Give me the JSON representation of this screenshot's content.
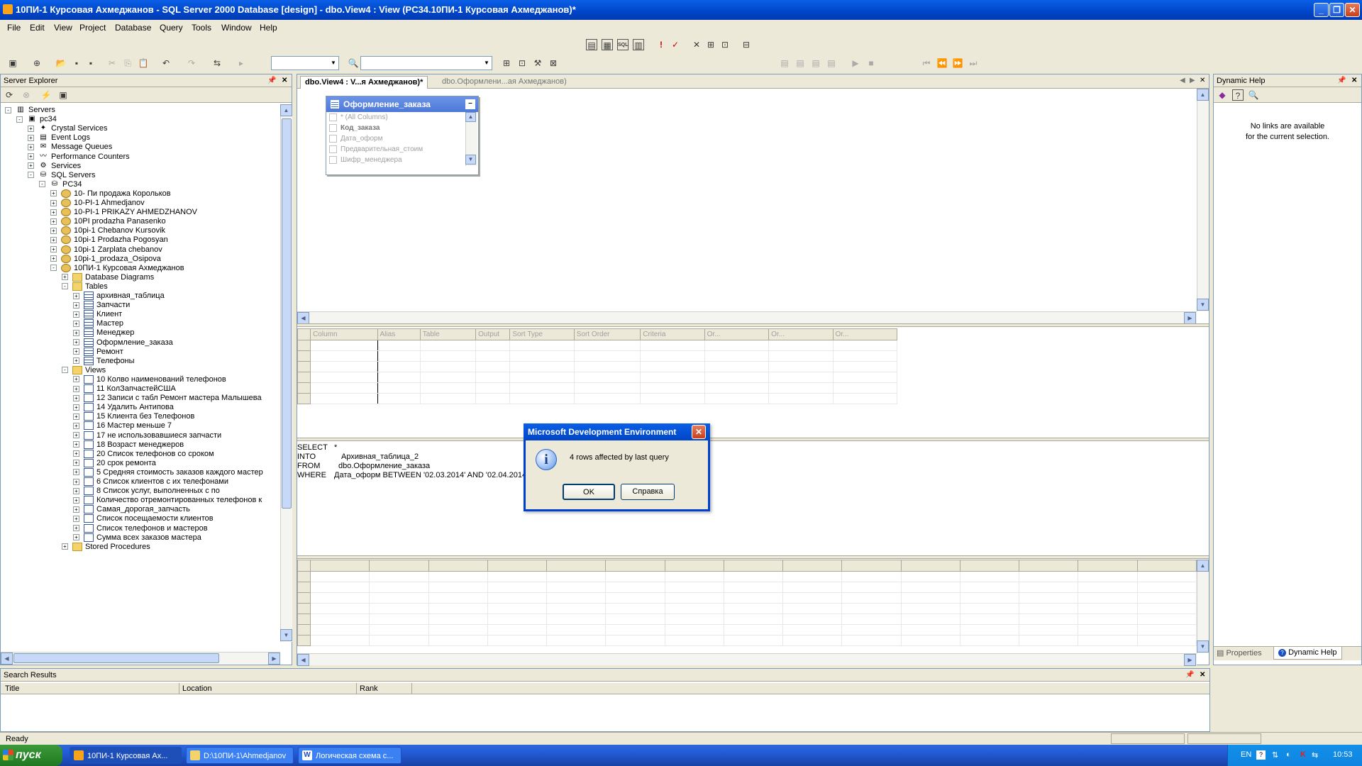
{
  "window": {
    "title": "10ПИ-1 Курсовая Ахмеджанов - SQL Server 2000 Database [design] - dbo.View4 : View (PC34.10ПИ-1 Курсовая Ахмеджанов)*"
  },
  "menu": [
    "File",
    "Edit",
    "View",
    "Project",
    "Database",
    "Query",
    "Tools",
    "Window",
    "Help"
  ],
  "server_explorer": {
    "title": "Server Explorer",
    "tree": [
      {
        "label": "Servers",
        "level": 0,
        "exp": "-",
        "icon": "servers-icon"
      },
      {
        "label": "pc34",
        "level": 1,
        "exp": "-",
        "icon": "computer-icon"
      },
      {
        "label": "Crystal Services",
        "level": 2,
        "exp": "+",
        "icon": "crystal-icon"
      },
      {
        "label": "Event Logs",
        "level": 2,
        "exp": "+",
        "icon": "event-log-icon"
      },
      {
        "label": "Message Queues",
        "level": 2,
        "exp": "+",
        "icon": "message-queue-icon"
      },
      {
        "label": "Performance Counters",
        "level": 2,
        "exp": "+",
        "icon": "perf-counter-icon"
      },
      {
        "label": "Services",
        "level": 2,
        "exp": "+",
        "icon": "services-icon"
      },
      {
        "label": "SQL Servers",
        "level": 2,
        "exp": "-",
        "icon": "sql-servers-icon"
      },
      {
        "label": "PC34",
        "level": 3,
        "exp": "-",
        "icon": "sql-server-icon"
      },
      {
        "label": "10- Пи продажа Корольков",
        "level": 4,
        "exp": "+",
        "icon": "database-icon"
      },
      {
        "label": "10-PI-1 Ahmedjanov",
        "level": 4,
        "exp": "+",
        "icon": "database-icon"
      },
      {
        "label": "10-PI-1 PRIKAZY AHMEDZHANOV",
        "level": 4,
        "exp": "+",
        "icon": "database-icon"
      },
      {
        "label": "10PI prodazha Panasenko",
        "level": 4,
        "exp": "+",
        "icon": "database-icon"
      },
      {
        "label": "10pi-1 Chebanov Kursovik",
        "level": 4,
        "exp": "+",
        "icon": "database-icon"
      },
      {
        "label": "10pi-1 Prodazha Pogosyan",
        "level": 4,
        "exp": "+",
        "icon": "database-icon"
      },
      {
        "label": "10pi-1 Zarplata chebanov",
        "level": 4,
        "exp": "+",
        "icon": "database-icon"
      },
      {
        "label": "10pi-1_prodaza_Osipova",
        "level": 4,
        "exp": "+",
        "icon": "database-icon"
      },
      {
        "label": "10ПИ-1 Курсовая Ахмеджанов",
        "level": 4,
        "exp": "-",
        "icon": "database-icon"
      },
      {
        "label": "Database Diagrams",
        "level": 5,
        "exp": "+",
        "icon": "folder-icon"
      },
      {
        "label": "Tables",
        "level": 5,
        "exp": "-",
        "icon": "folder-icon"
      },
      {
        "label": "архивная_таблица",
        "level": 6,
        "exp": "+",
        "icon": "table-icon"
      },
      {
        "label": "Запчасти",
        "level": 6,
        "exp": "+",
        "icon": "table-icon"
      },
      {
        "label": "Клиент",
        "level": 6,
        "exp": "+",
        "icon": "table-icon"
      },
      {
        "label": "Мастер",
        "level": 6,
        "exp": "+",
        "icon": "table-icon"
      },
      {
        "label": "Менеджер",
        "level": 6,
        "exp": "+",
        "icon": "table-icon"
      },
      {
        "label": "Оформление_заказа",
        "level": 6,
        "exp": "+",
        "icon": "table-icon"
      },
      {
        "label": "Ремонт",
        "level": 6,
        "exp": "+",
        "icon": "table-icon"
      },
      {
        "label": "Телефоны",
        "level": 6,
        "exp": "+",
        "icon": "table-icon"
      },
      {
        "label": "Views",
        "level": 5,
        "exp": "-",
        "icon": "folder-icon"
      },
      {
        "label": "10 Колво наименований телефонов",
        "level": 6,
        "exp": "+",
        "icon": "view-icon"
      },
      {
        "label": "11 КолЗапчастейСША",
        "level": 6,
        "exp": "+",
        "icon": "view-icon"
      },
      {
        "label": "12 Записи с табл Ремонт мастера Малышева",
        "level": 6,
        "exp": "+",
        "icon": "view-icon"
      },
      {
        "label": "14 Удалить Антипова",
        "level": 6,
        "exp": "+",
        "icon": "view-icon"
      },
      {
        "label": "15 Клиента без Телефонов",
        "level": 6,
        "exp": "+",
        "icon": "view-icon"
      },
      {
        "label": "16 Мастер меньше 7",
        "level": 6,
        "exp": "+",
        "icon": "view-icon"
      },
      {
        "label": "17 не использовавшиеся запчасти",
        "level": 6,
        "exp": "+",
        "icon": "view-icon"
      },
      {
        "label": "18 Возраст менеджеров",
        "level": 6,
        "exp": "+",
        "icon": "view-icon"
      },
      {
        "label": "20 Список телефонов со сроком",
        "level": 6,
        "exp": "+",
        "icon": "view-icon"
      },
      {
        "label": "20 срок ремонта",
        "level": 6,
        "exp": "+",
        "icon": "view-icon"
      },
      {
        "label": "5 Средняя стоимость заказов каждого мастер",
        "level": 6,
        "exp": "+",
        "icon": "view-icon"
      },
      {
        "label": "6 Список клиентов с их телефонами",
        "level": 6,
        "exp": "+",
        "icon": "view-icon"
      },
      {
        "label": "8 Список услуг, выполненных  с по",
        "level": 6,
        "exp": "+",
        "icon": "view-icon"
      },
      {
        "label": "Количество отремонтированных телефонов к",
        "level": 6,
        "exp": "+",
        "icon": "view-icon"
      },
      {
        "label": "Самая_дорогая_запчасть",
        "level": 6,
        "exp": "+",
        "icon": "view-icon"
      },
      {
        "label": "Список посещаемости клиентов",
        "level": 6,
        "exp": "+",
        "icon": "view-icon"
      },
      {
        "label": "Список телефонов и мастеров",
        "level": 6,
        "exp": "+",
        "icon": "view-icon"
      },
      {
        "label": "Сумма всех заказов мастера",
        "level": 6,
        "exp": "+",
        "icon": "view-icon"
      },
      {
        "label": "Stored Procedures",
        "level": 5,
        "exp": "+",
        "icon": "folder-icon"
      }
    ]
  },
  "tabs": [
    {
      "label": "dbo.View4 : V...я Ахмеджанов)*",
      "active": true
    },
    {
      "label": "dbo.Оформлени...ая Ахмеджанов)",
      "active": false
    }
  ],
  "diagram_table": {
    "title": "Оформление_заказа",
    "columns": [
      "* (All Columns)",
      "Код_заказа",
      "Дата_оформ",
      "Предварительная_стоим",
      "Шифр_менеджера"
    ]
  },
  "criteria_grid": {
    "headers": [
      "Column",
      "Alias",
      "Table",
      "Output",
      "Sort Type",
      "Sort Order",
      "Criteria",
      "Or...",
      "Or...",
      "Or..."
    ]
  },
  "sql": {
    "keywords": [
      "SELECT",
      "INTO",
      "FROM",
      "WHERE"
    ],
    "values": [
      "*",
      "Архивная_таблица_2",
      "dbo.Оформление_заказа",
      "Дата_оформ BETWEEN '02.03.2014' AND '02.04.2014'"
    ]
  },
  "dialog": {
    "title": "Microsoft Development Environment",
    "message": "4 rows affected by last query",
    "ok_label": "OK",
    "help_label": "Справка"
  },
  "dynamic_help": {
    "title": "Dynamic Help",
    "message_line1": "No links are available",
    "message_line2": "for the current selection.",
    "tab_properties": "Properties",
    "tab_dynamic_help": "Dynamic Help"
  },
  "search_results": {
    "title": "Search Results",
    "headers": [
      "Title",
      "Location",
      "Rank"
    ]
  },
  "status": {
    "text": "Ready"
  },
  "taskbar": {
    "start": "пуск",
    "tasks": [
      "10ПИ-1 Курсовая Ах...",
      "D:\\10ПИ-1\\Ahmedjanov",
      "Логическая схема с..."
    ],
    "lang": "EN",
    "time": "10:53"
  },
  "colors": {
    "titlebar": "#0045c8",
    "window_bg": "#ece9d8",
    "taskbar": "#245edc",
    "start_green": "#2d8a2d"
  }
}
